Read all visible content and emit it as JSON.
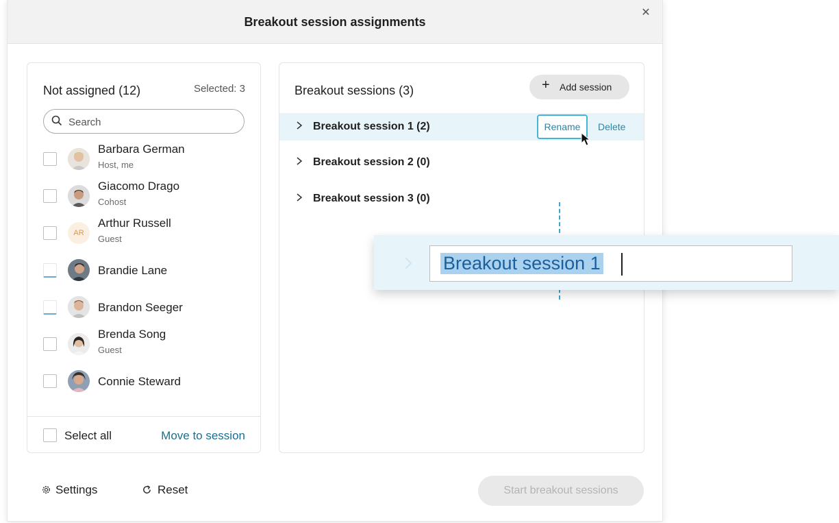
{
  "dialog": {
    "title": "Breakout session assignments",
    "close_icon": "close-icon"
  },
  "unassigned": {
    "title": "Not assigned (12)",
    "selected_text": "Selected: 3",
    "search_placeholder": "Search",
    "people": [
      {
        "name": "Barbara German",
        "role": "Host, me"
      },
      {
        "name": "Giacomo Drago",
        "role": "Cohost"
      },
      {
        "name": "Arthur Russell",
        "role": "Guest",
        "initials": "AR"
      },
      {
        "name": "Brandie Lane",
        "role": ""
      },
      {
        "name": "Brandon Seeger",
        "role": ""
      },
      {
        "name": "Brenda Song",
        "role": "Guest"
      },
      {
        "name": "Connie Steward",
        "role": ""
      }
    ],
    "select_all_label": "Select all",
    "move_label": "Move to session"
  },
  "sessions": {
    "title": "Breakout sessions (3)",
    "add_label": "Add session",
    "items": [
      {
        "label": "Breakout session 1 (2)"
      },
      {
        "label": "Breakout session 2 (0)"
      },
      {
        "label": "Breakout session 3 (0)"
      }
    ],
    "rename_label": "Rename",
    "delete_label": "Delete"
  },
  "rename_callout": {
    "value": "Breakout session 1"
  },
  "footer": {
    "settings_label": "Settings",
    "reset_label": "Reset",
    "start_label": "Start breakout sessions"
  },
  "colors": {
    "accent": "#1a6f8f",
    "highlight_row": "#e7f5fb",
    "rename_border": "#44b4d8"
  }
}
